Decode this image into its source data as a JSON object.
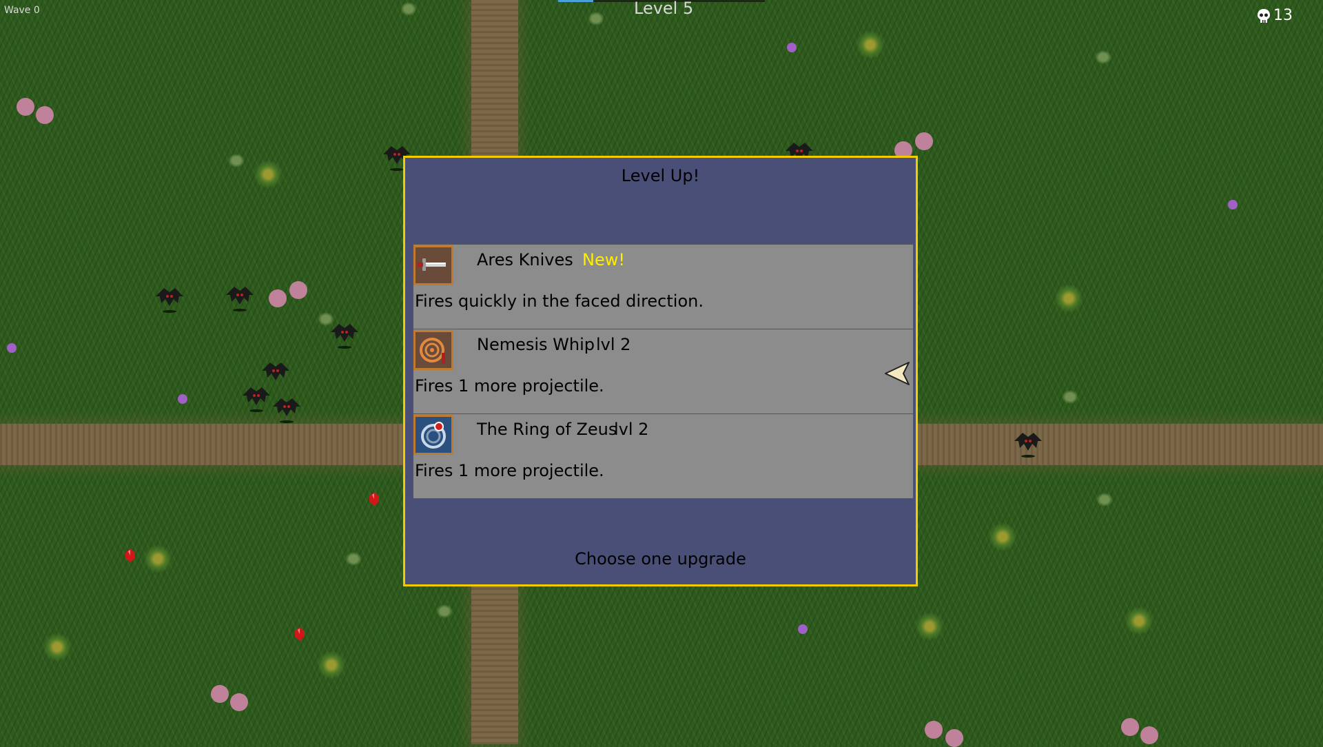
{
  "hud": {
    "wave": "Wave 0",
    "level": "Level 5",
    "xp_fraction": 0.17,
    "kills": "13"
  },
  "dialog": {
    "title": "Level Up!",
    "footer": "Choose one upgrade",
    "options": [
      {
        "icon": "knife-icon",
        "name": "Ares Knives",
        "tag": "New!",
        "description": "Fires quickly in the faced direction."
      },
      {
        "icon": "whip-icon",
        "name": "Nemesis Whip",
        "tag": "lvl 2",
        "description": "Fires 1 more projectile."
      },
      {
        "icon": "ring-icon",
        "name": "The Ring of Zeus",
        "tag": "lvl 2",
        "description": "Fires 1 more projectile."
      }
    ]
  },
  "colors": {
    "border": "#f2cc00",
    "panel": "#4a4f78",
    "option_bg": "#8c8c8c",
    "new_tag": "#ffee00"
  }
}
